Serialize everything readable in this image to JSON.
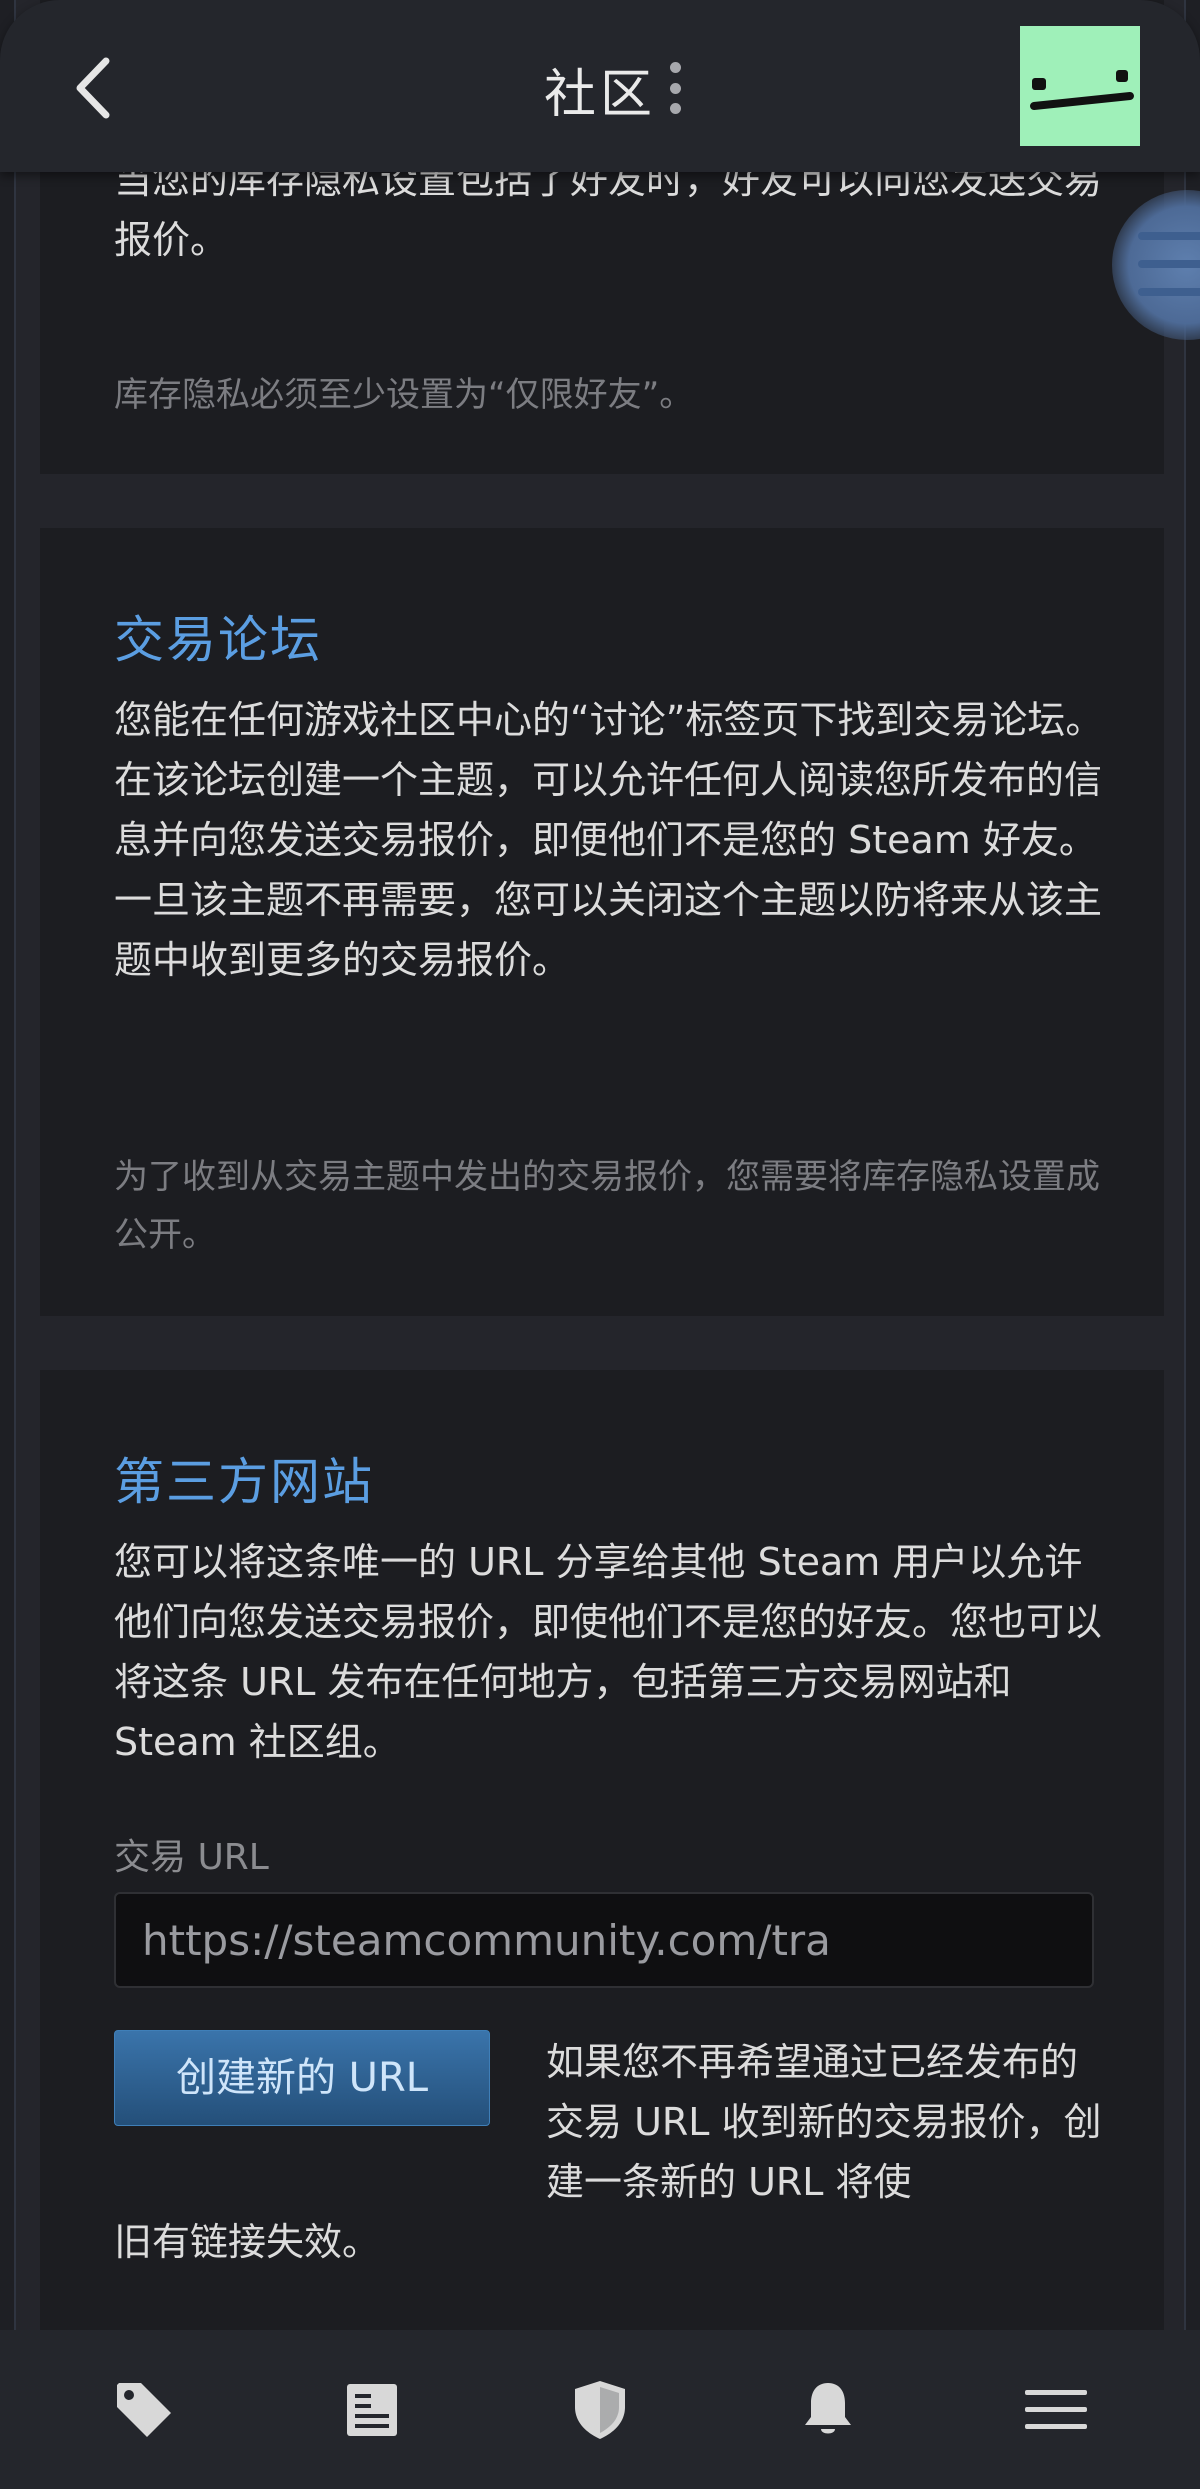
{
  "header": {
    "title": "社区"
  },
  "sections": {
    "friends_partial": {
      "text": "当您的库存隐私设置包括了好友时，好友可以向您发送交易报价。",
      "note": "库存隐私必须至少设置为“仅限好友”。"
    },
    "trade_forums": {
      "heading": "交易论坛",
      "text": "您能在任何游戏社区中心的“讨论”标签页下找到交易论坛。在该论坛创建一个主题，可以允许任何人阅读您所发布的信息并向您发送交易报价，即便他们不是您的 Steam 好友。一旦该主题不再需要，您可以关闭这个主题以防将来从该主题中收到更多的交易报价。",
      "note": "为了收到从交易主题中发出的交易报价，您需要将库存隐私设置成公开。"
    },
    "third_party": {
      "heading": "第三方网站",
      "text": "您可以将这条唯一的 URL 分享给其他 Steam 用户以允许他们向您发送交易报价，即使他们不是您的好友。您也可以将这条 URL 发布在任何地方，包括第三方交易网站和 Steam 社区组。",
      "url_label": "交易 URL",
      "url_value": "https://steamcommunity.com/tra",
      "new_url_button": "创建新的 URL",
      "new_url_desc_side": "如果您不再希望通过已经发布的交易 URL 收到新的交易报价，创建一条新的 URL 将使",
      "new_url_desc_tail": "旧有链接失效。"
    }
  },
  "bottom_nav": {
    "items": [
      {
        "icon": "tag-icon"
      },
      {
        "icon": "news-icon"
      },
      {
        "icon": "shield-icon"
      },
      {
        "icon": "bell-icon"
      },
      {
        "icon": "menu-icon"
      }
    ]
  },
  "colors": {
    "accent": "#5b9ee2",
    "button": "#2f6497",
    "avatar_bg": "#9ff0b9"
  }
}
